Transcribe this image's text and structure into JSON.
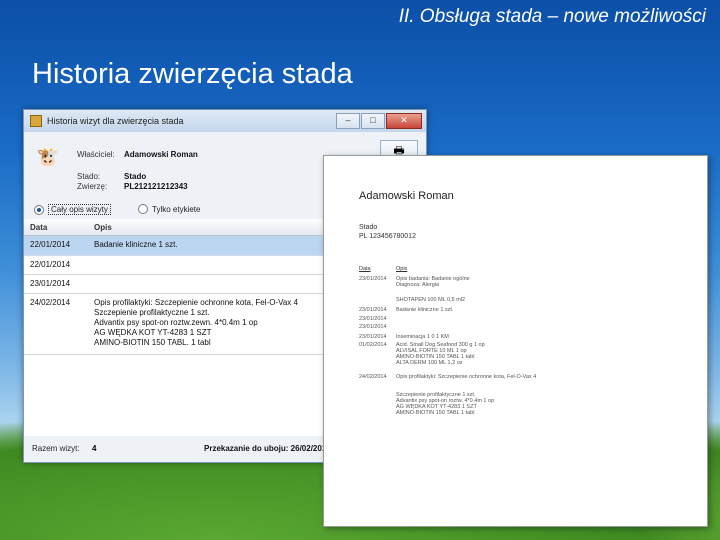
{
  "slide": {
    "section_title": "II. Obsługa stada – nowe możliwości",
    "title": "Historia zwierzęcia stada"
  },
  "window": {
    "title": "Historia wizyt dla zwierzęcia stada",
    "owner_label": "Właściciel:",
    "owner_value": "Adamowski Roman",
    "herd_label": "Stado:",
    "herd_value": "Stado",
    "animal_label": "Zwierzę:",
    "animal_value": "PL212121212343",
    "radio_all": "Cały opis wizyty",
    "radio_only": "Tylko etykiete",
    "col_date": "Data",
    "col_desc": "Opis",
    "rows": [
      {
        "date": "22/01/2014",
        "desc": "Badanie kliniczne 1 szt."
      },
      {
        "date": "22/01/2014",
        "desc": ""
      },
      {
        "date": "23/01/2014",
        "desc": ""
      },
      {
        "date": "24/02/2014",
        "desc": "Opis profilaktyki: Szczepienie ochronne kota, Fel-O-Vax 4\nSzczepienie profilaktyczne 1 szt.\nAdvantix psy spot-on roztw.zewn. 4*0.4m 1 op\nAG WĘDKA KOT YT-4283 1 SZT\nAMINO-BIOTIN 150 TABL. 1 tabl"
      }
    ],
    "visits_label": "Razem wizyt:",
    "visits_value": "4",
    "slaughter": "Przekazanie do uboju: 26/02/2014"
  },
  "document": {
    "name": "Adamowski Roman",
    "herd": "Stado",
    "herd_code": "PL 123456780012",
    "col_date": "Data",
    "col_desc": "Opis",
    "entries": [
      {
        "date": "23/01/2014",
        "desc": "Opis badania: Badanie ogólne\nDiagnoza: Alergia"
      },
      {
        "date": "",
        "desc": "SHOTAPEN 100 ML 0,5 ml2"
      },
      {
        "date": "23/01/2014",
        "desc": "Badanie kliniczne 1 szt."
      },
      {
        "date": "23/01/2014",
        "desc": ""
      },
      {
        "date": "23/01/2014",
        "desc": ""
      },
      {
        "date": "23/01/2014",
        "desc": "Inseminacja 1 0 1 KM"
      },
      {
        "date": "01/02/2014",
        "desc": "Acid. Small Dog Seafood 300 g 1 op\nALVISAL FORTE 10 ML 1 op\nAMINO-BIOTIN 150 TABL 1 tabl\nALTA DERM 100 ML 1,2 oz"
      },
      {
        "date": "24/02/2014",
        "desc": "Opis profilaktyki: Szczepienie ochronne kota, Fel-O-Vax 4"
      },
      {
        "date": "",
        "desc": "Szczepienie profilaktyczne 1 szt.\nAdvantix psy spot-on roztw. 4*0.4m 1 op\nAG WĘDKA KOT YT-4283 1 SZT\nAMINO-BIOTIN 150 TABL 1 tabl"
      }
    ]
  }
}
